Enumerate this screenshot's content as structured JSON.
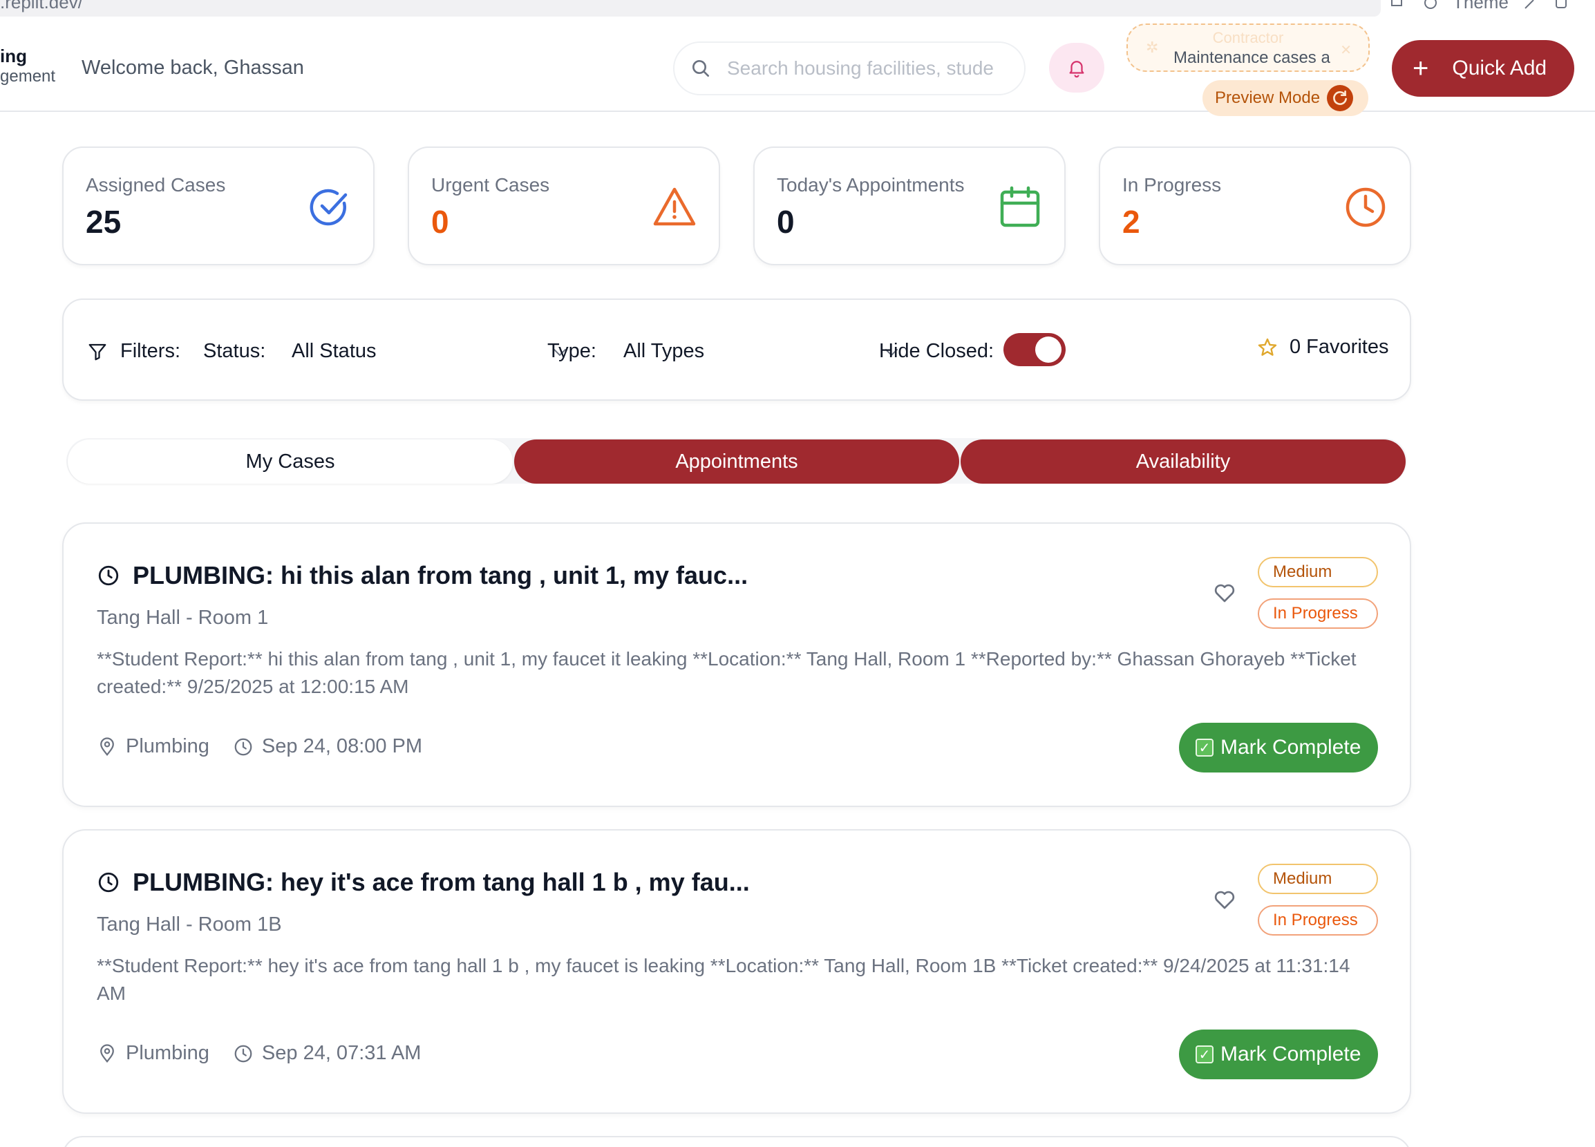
{
  "browser": {
    "url": ".replit.dev/",
    "theme_label": "Theme"
  },
  "header": {
    "brand_line1": "ing",
    "brand_line2": "gement",
    "welcome": "Welcome back, Ghassan",
    "search_placeholder": "Search housing facilities, stude",
    "contractor_title": "Contractor",
    "contractor_message": "Maintenance cases a",
    "preview_label": "Preview Mode",
    "quick_add_label": "Quick Add"
  },
  "stats": [
    {
      "label": "Assigned Cases",
      "value": "25",
      "color": "#111827",
      "icon": "check-circle-icon",
      "icon_color": "#3b6fe0"
    },
    {
      "label": "Urgent Cases",
      "value": "0",
      "color": "#ea580c",
      "icon": "warning-triangle-icon",
      "icon_color": "#ea6a2c"
    },
    {
      "label": "Today's Appointments",
      "value": "0",
      "color": "#111827",
      "icon": "calendar-icon",
      "icon_color": "#3fae55"
    },
    {
      "label": "In Progress",
      "value": "2",
      "color": "#ea580c",
      "icon": "clock-icon",
      "icon_color": "#ea6a2c"
    }
  ],
  "filters": {
    "filters_label": "Filters:",
    "status_label": "Status:",
    "status_value": "All Status",
    "type_label": "Type:",
    "type_value": "All Types",
    "hide_closed_label": "Hide Closed:",
    "hide_closed_on": true,
    "favorites_label": "0 Favorites"
  },
  "tabs": [
    {
      "label": "My Cases",
      "active": true
    },
    {
      "label": "Appointments",
      "active": false
    },
    {
      "label": "Availability",
      "active": false
    }
  ],
  "cases": [
    {
      "title": "PLUMBING: hi this alan from tang , unit 1, my fauc...",
      "location": "Tang Hall - Room 1",
      "description": "**Student Report:** hi this alan from tang , unit 1, my faucet it leaking **Location:** Tang Hall, Room 1 **Reported by:** Ghassan Ghorayeb **Ticket created:** 9/25/2025 at 12:00:15 AM",
      "category": "Plumbing",
      "datetime": "Sep 24, 08:00 PM",
      "priority": "Medium",
      "status": "In Progress",
      "action": "Mark Complete"
    },
    {
      "title": "PLUMBING: hey it's ace from tang hall 1 b , my fau...",
      "location": "Tang Hall - Room 1B",
      "description": "**Student Report:** hey it's ace from tang hall 1 b , my faucet is leaking **Location:** Tang Hall, Room 1B **Ticket created:** 9/24/2025 at 11:31:14 AM",
      "category": "Plumbing",
      "datetime": "Sep 24, 07:31 AM",
      "priority": "Medium",
      "status": "In Progress",
      "action": "Mark Complete"
    }
  ],
  "colors": {
    "brand_red": "#a0292f",
    "success_green": "#3d9a43"
  }
}
